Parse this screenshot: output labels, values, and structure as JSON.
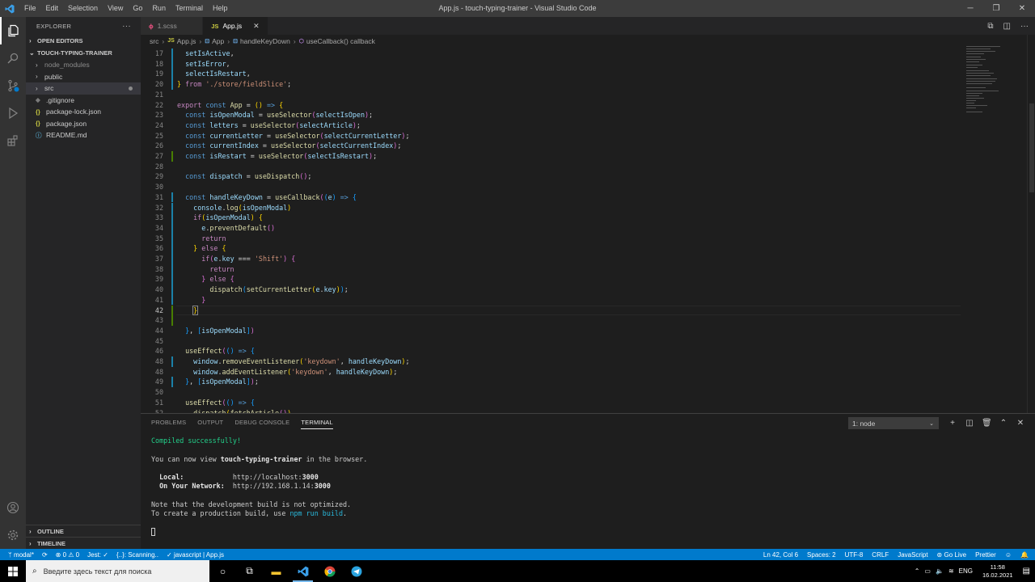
{
  "window": {
    "title": "App.js - touch-typing-trainer - Visual Studio Code",
    "menu": [
      "File",
      "Edit",
      "Selection",
      "View",
      "Go",
      "Run",
      "Terminal",
      "Help"
    ]
  },
  "sidebar": {
    "header": "EXPLORER",
    "open_editors": "OPEN EDITORS",
    "project": "TOUCH-TYPING-TRAINER",
    "items": [
      {
        "label": "node_modules",
        "type": "folder"
      },
      {
        "label": "public",
        "type": "folder"
      },
      {
        "label": "src",
        "type": "folder"
      },
      {
        "label": ".gitignore",
        "type": "file"
      },
      {
        "label": "package-lock.json",
        "type": "json"
      },
      {
        "label": "package.json",
        "type": "json"
      },
      {
        "label": "README.md",
        "type": "md"
      }
    ],
    "outline": "OUTLINE",
    "timeline": "TIMELINE"
  },
  "tabs": [
    {
      "label": "1.scss",
      "icon": "ϕ",
      "active": false
    },
    {
      "label": "App.js",
      "icon": "JS",
      "active": true
    }
  ],
  "breadcrumb": [
    "src",
    "App.js",
    "App",
    "handleKeyDown",
    "useCallback() callback"
  ],
  "panel": {
    "tabs": [
      "PROBLEMS",
      "OUTPUT",
      "DEBUG CONSOLE",
      "TERMINAL"
    ],
    "terminal_select": "1: node",
    "terminal": {
      "compiled": "Compiled successfully!",
      "view_prefix": "You can now view ",
      "app_name": "touch-typing-trainer",
      "view_suffix": " in the browser.",
      "local_label": "Local:",
      "local_url_prefix": "http://localhost:",
      "local_port": "3000",
      "network_label": "On Your Network:",
      "network_url_prefix": "http://192.168.1.14:",
      "network_port": "3000",
      "note1": "Note that the development build is not optimized.",
      "note2_prefix": "To create a production build, use ",
      "note2_cmd": "npm run build",
      "note2_suffix": "."
    }
  },
  "statusbar": {
    "branch": "modal*",
    "errors": "0",
    "warnings": "0",
    "jest": "Jest: ✓",
    "scanning": "{..}: Scanning..",
    "lang_check": "javascript | App.js",
    "position": "Ln 42, Col 6",
    "spaces": "Spaces: 2",
    "encoding": "UTF-8",
    "eol": "CRLF",
    "language": "JavaScript",
    "golive": "Go Live",
    "prettier": "Prettier"
  },
  "taskbar": {
    "search_placeholder": "Введите здесь текст для поиска",
    "lang": "ENG",
    "time": "11:58",
    "date": "16.02.2021"
  },
  "colors": {
    "accent": "#007acc",
    "titlebar": "#3c3c3c",
    "activitybar": "#333333",
    "sidebar": "#252526",
    "editor": "#1e1e1e"
  }
}
